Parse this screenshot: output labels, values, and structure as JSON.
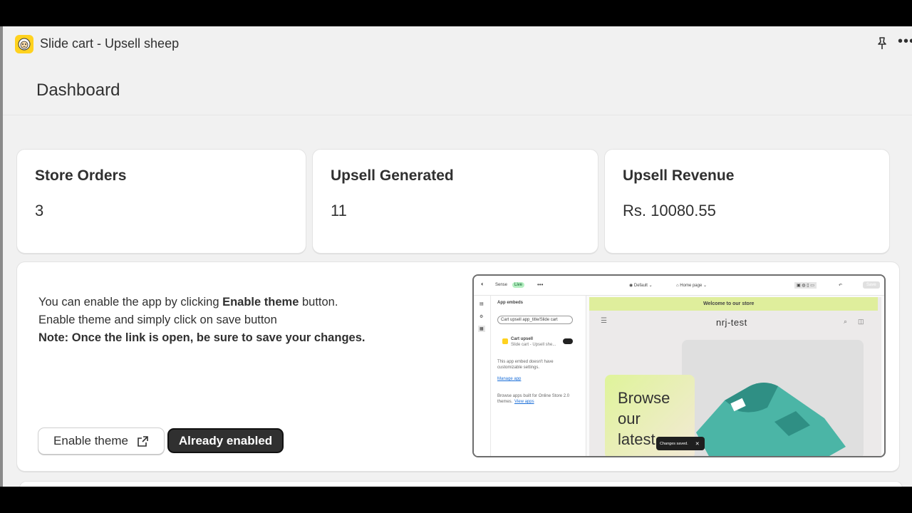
{
  "app": {
    "title": "Slide cart - Upsell sheep",
    "icon": "sheep-logo-icon",
    "brand_color": "#ffd21f"
  },
  "header": {
    "page_title": "Dashboard"
  },
  "stats": [
    {
      "label": "Store Orders",
      "value": "3"
    },
    {
      "label": "Upsell Generated",
      "value": "11"
    },
    {
      "label": "Upsell Revenue",
      "value": "Rs. 10080.55"
    }
  ],
  "info": {
    "line1_prefix": "You can enable the app by clicking ",
    "line1_bold": "Enable theme",
    "line1_suffix": " button.",
    "line2": "Enable theme and simply click on save button",
    "note": "Note: Once the link is open, be sure to save your changes."
  },
  "buttons": {
    "enable_theme": "Enable theme",
    "already_enabled": "Already enabled"
  },
  "preview": {
    "theme_name": "Sense",
    "live_badge": "Live",
    "template": "Default",
    "page": "Home page",
    "save": "Save",
    "panel_title": "App embeds",
    "search_value": "Cart upsell app_title/Slide cart",
    "embed_name": "Cart upsell",
    "embed_sub": "Slide cart - Upsell she...",
    "no_settings": "This app embed doesn't have",
    "no_settings2": "customizable settings.",
    "manage_app": "Manage app",
    "browse1": "Browse apps built for Online Store 2.0",
    "browse2": "themes.",
    "view_apps": "View apps",
    "banner": "Welcome to our store",
    "store_name": "nrj-test",
    "hero_line1": "Browse",
    "hero_line2": "our",
    "hero_line3": "latest",
    "toast": "Changes saved."
  }
}
